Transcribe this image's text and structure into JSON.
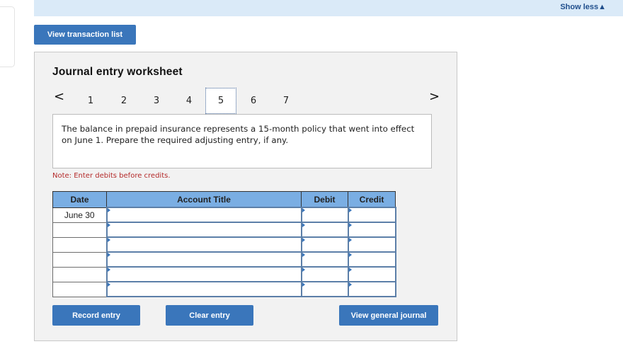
{
  "header": {
    "show_less_label": "Show less",
    "show_less_icon": "▲"
  },
  "toolbar": {
    "view_transaction_list_label": "View transaction list"
  },
  "worksheet": {
    "title": "Journal entry worksheet",
    "nav": {
      "prev_icon": "<",
      "next_icon": ">",
      "tabs": [
        {
          "label": "1",
          "active": false
        },
        {
          "label": "2",
          "active": false
        },
        {
          "label": "3",
          "active": false
        },
        {
          "label": "4",
          "active": false
        },
        {
          "label": "5",
          "active": true
        },
        {
          "label": "6",
          "active": false
        },
        {
          "label": "7",
          "active": false
        }
      ]
    },
    "question": "The balance in prepaid insurance represents a 15-month policy that went into effect on June 1. Prepare the required adjusting entry, if any.",
    "note": "Note: Enter debits before credits.",
    "table": {
      "headers": {
        "date": "Date",
        "account_title": "Account Title",
        "debit": "Debit",
        "credit": "Credit"
      },
      "rows": [
        {
          "date": "June 30",
          "account_title": "",
          "debit": "",
          "credit": ""
        },
        {
          "date": "",
          "account_title": "",
          "debit": "",
          "credit": ""
        },
        {
          "date": "",
          "account_title": "",
          "debit": "",
          "credit": ""
        },
        {
          "date": "",
          "account_title": "",
          "debit": "",
          "credit": ""
        },
        {
          "date": "",
          "account_title": "",
          "debit": "",
          "credit": ""
        },
        {
          "date": "",
          "account_title": "",
          "debit": "",
          "credit": ""
        }
      ]
    },
    "buttons": {
      "record_entry": "Record entry",
      "clear_entry": "Clear entry",
      "view_general_journal": "View general journal"
    }
  },
  "colors": {
    "accent": "#3a76bb",
    "header_bar": "#daeaf8",
    "table_header": "#7aaee3",
    "note_red": "#b42a2a"
  }
}
